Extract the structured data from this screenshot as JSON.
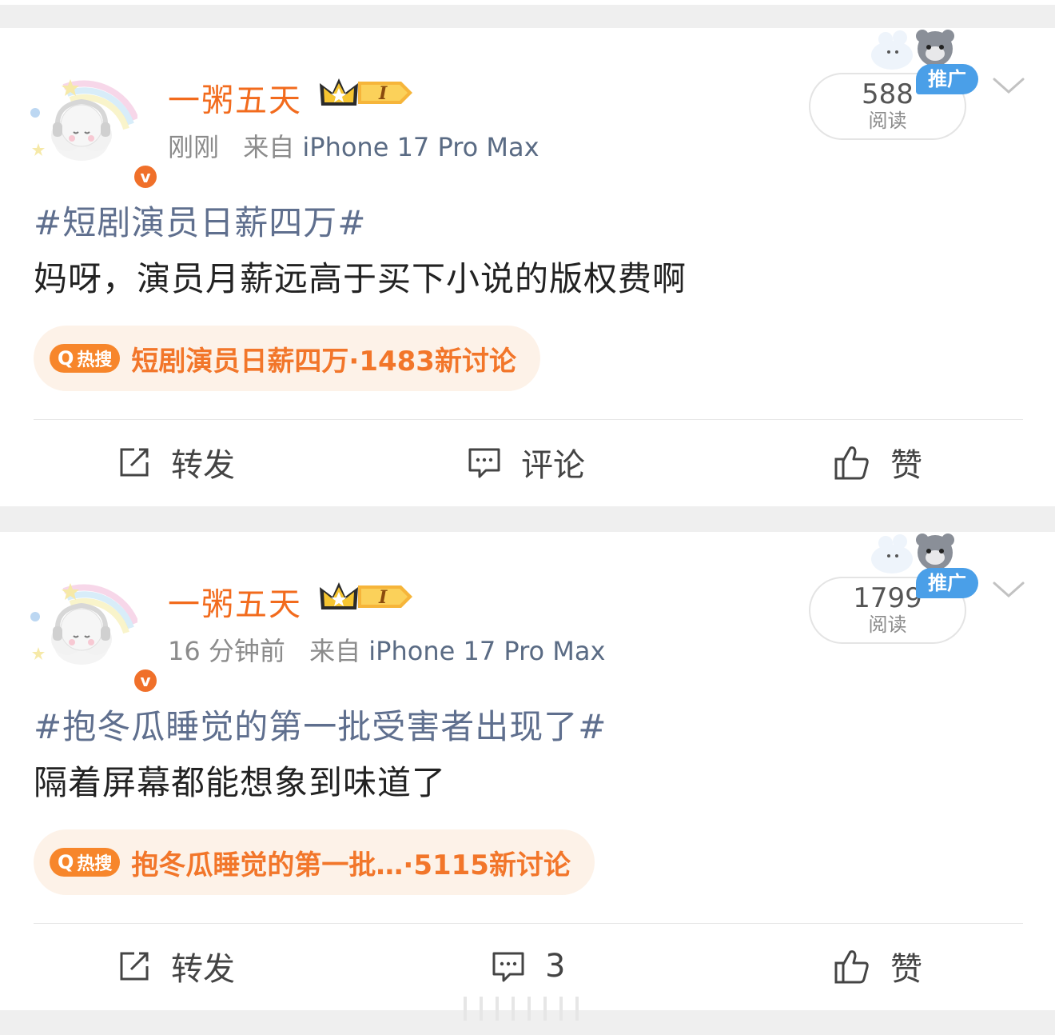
{
  "colors": {
    "username": "#f26b1d",
    "topic": "#5f6f8e",
    "hot_accent": "#f7862b",
    "hot_bg": "#fdf2e8",
    "promo": "#4a9fe8",
    "verified": "#f0702a"
  },
  "posts": [
    {
      "username": "一粥五天",
      "level_badge": "I",
      "time": "刚刚",
      "source_prefix": "来自",
      "source": "iPhone 17 Pro Max",
      "reads_count": "588",
      "reads_label": "阅读",
      "promo_label": "推广",
      "topic": "#短剧演员日薪四万#",
      "content": "妈呀，演员月薪远高于买下小说的版权费啊",
      "hot_tag": "热搜",
      "hot_title": "短剧演员日薪四万",
      "hot_count": "·1483新讨论",
      "repost_label": "转发",
      "comment_label": "评论",
      "like_label": "赞",
      "icons": [
        "avatar-cloud-icon",
        "crown-icon",
        "chevron-down-icon",
        "search-icon",
        "repost-icon",
        "comment-icon",
        "like-icon"
      ]
    },
    {
      "username": "一粥五天",
      "level_badge": "I",
      "time": "16 分钟前",
      "source_prefix": "来自",
      "source": "iPhone 17 Pro Max",
      "reads_count": "1799",
      "reads_label": "阅读",
      "promo_label": "推广",
      "topic": "#抱冬瓜睡觉的第一批受害者出现了#",
      "content": "隔着屏幕都能想象到味道了",
      "hot_tag": "热搜",
      "hot_title": "抱冬瓜睡觉的第一批…",
      "hot_count": " ·5115新讨论",
      "repost_label": "转发",
      "comment_label": "3",
      "like_label": "赞",
      "icons": [
        "avatar-cloud-icon",
        "crown-icon",
        "chevron-down-icon",
        "search-icon",
        "repost-icon",
        "comment-icon",
        "like-icon"
      ]
    }
  ]
}
